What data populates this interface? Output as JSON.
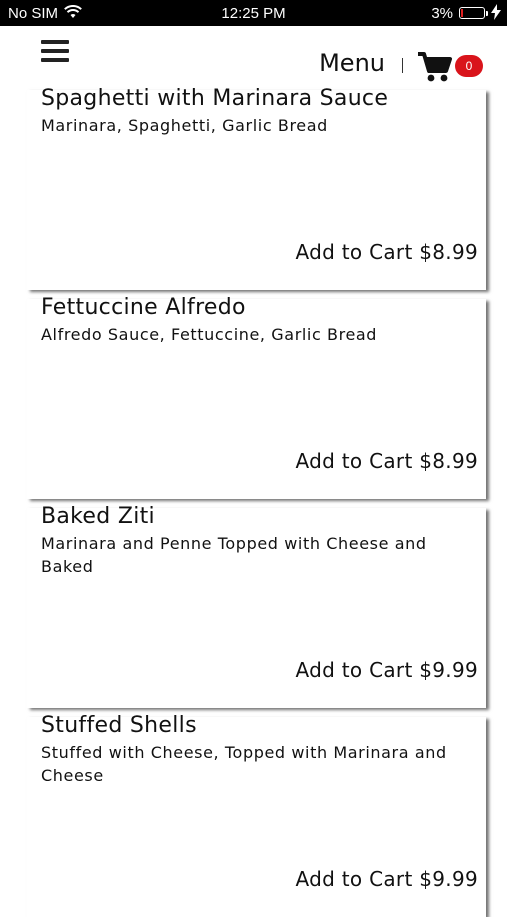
{
  "status_bar": {
    "carrier": "No SIM",
    "time": "12:25 PM",
    "battery_percent": "3%",
    "battery_level": 0.03,
    "icons": [
      "wifi-icon",
      "battery-icon",
      "charging-bolt-icon"
    ]
  },
  "header": {
    "title": "Menu",
    "cart_count": "0",
    "icons": [
      "hamburger-menu-icon",
      "shopping-cart-icon"
    ],
    "badge_color": "#d9141b"
  },
  "items": [
    {
      "name": "Spaghetti with Marinara Sauce",
      "description": "Marinara, Spaghetti, Garlic Bread",
      "action": "Add to Cart $8.99"
    },
    {
      "name": "Fettuccine Alfredo",
      "description": "Alfredo Sauce, Fettuccine, Garlic Bread",
      "action": "Add to Cart $8.99"
    },
    {
      "name": "Baked Ziti",
      "description": "Marinara and Penne Topped with Cheese and Baked",
      "action": "Add to Cart $9.99"
    },
    {
      "name": "Stuffed Shells",
      "description": "Stuffed with Cheese, Topped with Marinara and Cheese",
      "action": "Add to Cart $9.99"
    }
  ]
}
